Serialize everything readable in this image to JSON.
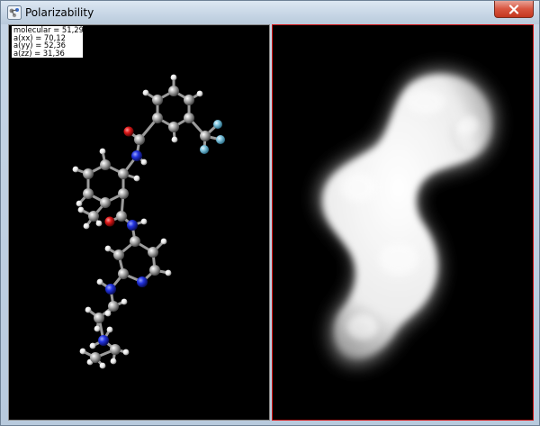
{
  "window": {
    "title": "Polarizability",
    "close_icon": "close-icon",
    "app_icon": "molecule-window-icon"
  },
  "readout": {
    "molecular": "molecular = 51,29",
    "axx": "a(xx) = 70,12",
    "ayy": "a(yy) = 52,36",
    "azz": "a(zz) = 31,36"
  },
  "views": {
    "left": "ball-and-stick molecule view",
    "right": "molecular surface view"
  },
  "colors": {
    "carbon": "#9a9a9a",
    "hydrogen": "#e8e8e8",
    "nitrogen": "#1f2fd8",
    "oxygen": "#d81a1a",
    "fluorine": "#7fc4dd",
    "surface": "#f2f2f2",
    "active_border": "#d01616"
  }
}
